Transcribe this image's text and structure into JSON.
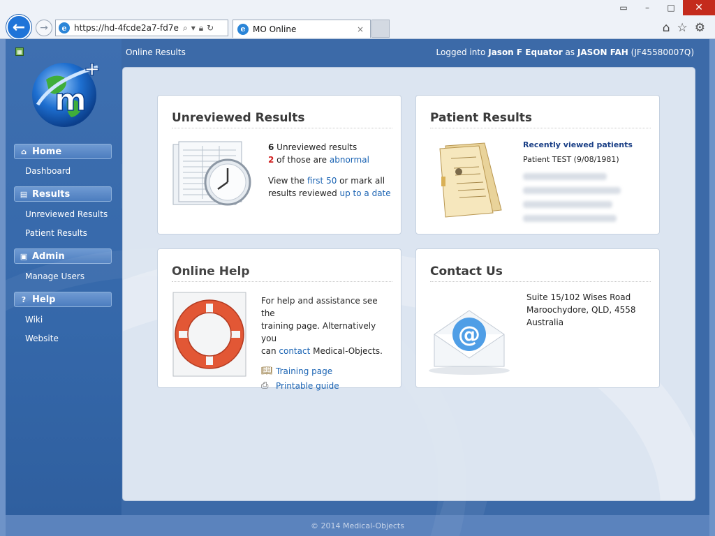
{
  "browser": {
    "url": "https://hd-4fcde2a7-fd7e-...",
    "tab_title": "MO Online",
    "tab_close": "×",
    "back_glyph": "←",
    "forward_glyph": "→",
    "icons": [
      "search-icon",
      "lock-icon",
      "refresh-icon",
      "home-icon",
      "favorites-star-icon",
      "settings-gear-icon"
    ]
  },
  "header": {
    "breadcrumb": "Online Results",
    "logged_prefix": "Logged into",
    "org": "Jason F Equator",
    "as": "as",
    "user": "JASON FAH",
    "user_id": "(JF45580007Q)"
  },
  "sidebar": {
    "sections": [
      {
        "title": "Home",
        "icon": "house-icon",
        "items": [
          "Dashboard"
        ]
      },
      {
        "title": "Results",
        "icon": "report-icon",
        "items": [
          "Unreviewed Results",
          "Patient Results"
        ]
      },
      {
        "title": "Admin",
        "icon": "admin-icon",
        "items": [
          "Manage Users"
        ]
      },
      {
        "title": "Help",
        "icon": "help-icon",
        "items": [
          "Wiki",
          "Website"
        ]
      }
    ]
  },
  "cards": {
    "unreviewed": {
      "title": "Unreviewed Results",
      "count": "6",
      "count_text": " Unreviewed results",
      "abnormal_count": "2",
      "abnormal_text_pre": " of those are ",
      "abnormal_link": "abnormal",
      "view_pre": "View the ",
      "first_link": "first 50",
      "view_mid": " or mark all",
      "view_line2": "results reviewed ",
      "date_link": "up to a date"
    },
    "patient": {
      "title": "Patient Results",
      "recent_heading": "Recently viewed patients",
      "recent_patient": "Patient TEST (9/08/1981)"
    },
    "help": {
      "title": "Online Help",
      "text1": "For help and assistance see the",
      "text2": "training page. Alternatively you",
      "text3_pre": "can ",
      "contact_link": "contact",
      "text3_post": " Medical-Objects.",
      "training_link": "Training page",
      "guide_link": "Printable guide"
    },
    "contact": {
      "title": "Contact Us",
      "address1": "Suite 15/102 Wises Road",
      "address2": "Maroochydore, QLD, 4558",
      "address3": "Australia",
      "at_symbol": "@"
    }
  },
  "footer": {
    "text": "© 2014 Medical-Objects"
  },
  "colors": {
    "accent": "#1a63b3",
    "sidebar": "#3568aa",
    "abnormal": "#d02020"
  }
}
